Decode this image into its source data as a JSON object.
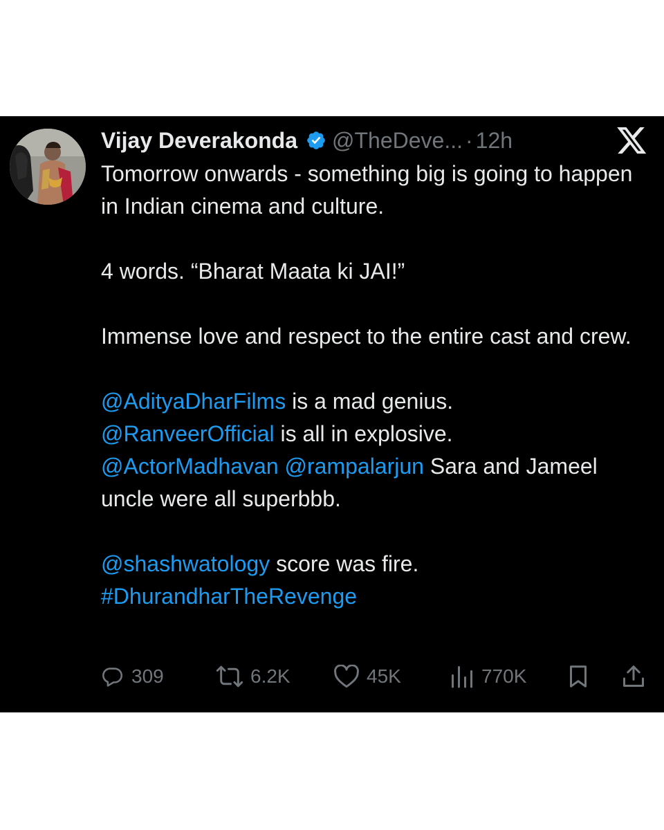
{
  "author": {
    "name": "Vijay Deverakonda",
    "handle": "@TheDeve...",
    "separator": "·",
    "time": "12h"
  },
  "icons": {
    "verified": "verified-badge-icon",
    "platform": "x-logo-icon",
    "reply": "reply-icon",
    "repost": "repost-icon",
    "like": "like-icon",
    "views": "views-icon",
    "bookmark": "bookmark-icon",
    "share": "share-icon"
  },
  "colors": {
    "background": "#000000",
    "text": "#e7e9ea",
    "muted": "#71767b",
    "link": "#1d9bf0",
    "verified": "#1d9bf0"
  },
  "tweet": {
    "p1": "Tomorrow onwards - something big is going to happen in Indian cinema and culture.",
    "p2": "4 words. “Bharat Maata ki JAI!”",
    "p3": "Immense love and respect to the entire cast and crew.",
    "mention1": "@AdityaDharFilms",
    "text1": " is a mad genius.",
    "mention2": "@RanveerOfficial",
    "text2": " is all in explosive.",
    "mention3": "@ActorMadhavan",
    "space": " ",
    "mention4": "@rampalarjun",
    "text3": " Sara and Jameel uncle were all superbbb.",
    "mention5": "@shashwatology",
    "text4": " score was fire.",
    "hashtag": "#DhurandharTheRevenge"
  },
  "stats": {
    "replies": "309",
    "reposts": "6.2K",
    "likes": "45K",
    "views": "770K"
  }
}
